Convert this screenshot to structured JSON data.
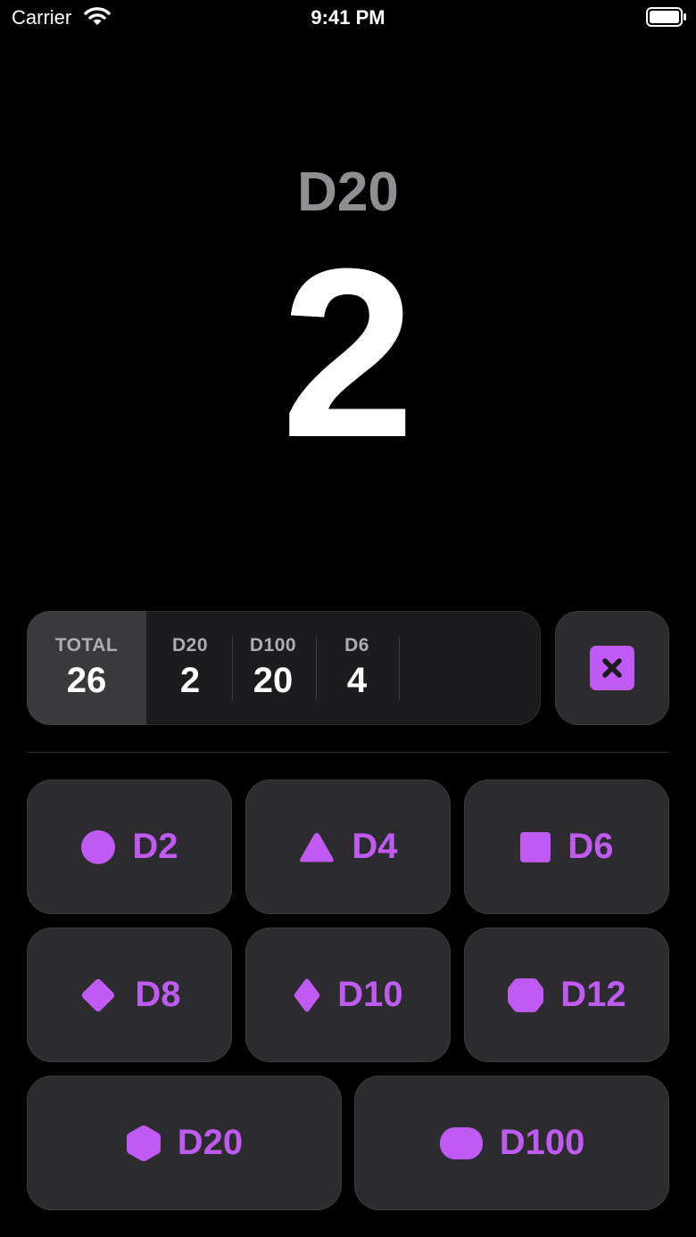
{
  "status_bar": {
    "carrier": "Carrier",
    "time": "9:41 PM"
  },
  "current_roll": {
    "die": "D20",
    "value": "2"
  },
  "history": {
    "total_label": "TOTAL",
    "total_value": "26",
    "rolls": [
      {
        "die": "D20",
        "value": "2"
      },
      {
        "die": "D100",
        "value": "20"
      },
      {
        "die": "D6",
        "value": "4"
      }
    ]
  },
  "dice": [
    {
      "label": "D2",
      "icon": "circle-icon"
    },
    {
      "label": "D4",
      "icon": "triangle-icon"
    },
    {
      "label": "D6",
      "icon": "square-icon"
    },
    {
      "label": "D8",
      "icon": "diamond-icon"
    },
    {
      "label": "D10",
      "icon": "rhombus-icon"
    },
    {
      "label": "D12",
      "icon": "octagon-icon"
    },
    {
      "label": "D20",
      "icon": "hexagon-icon"
    },
    {
      "label": "D100",
      "icon": "pill-icon"
    }
  ],
  "colors": {
    "accent": "#bf5af2",
    "button_bg": "#2c2c2e",
    "background": "#000000",
    "secondary_text": "#8e8e93"
  }
}
